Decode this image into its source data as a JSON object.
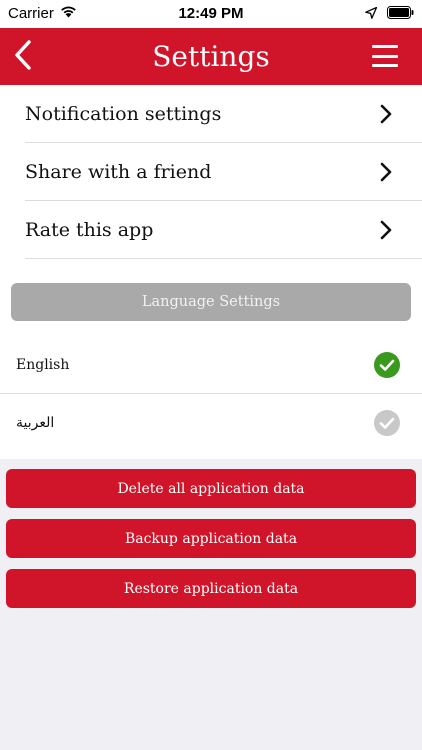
{
  "status_bar": {
    "carrier": "Carrier",
    "time": "12:49 PM"
  },
  "navbar": {
    "title": "Settings",
    "back_icon": "chevron-left-icon",
    "menu_icon": "hamburger-menu-icon",
    "bg_color": "#d0142a"
  },
  "settings": {
    "items": [
      {
        "label": "Notification settings",
        "icon": "chevron-right-icon"
      },
      {
        "label": "Share with a friend",
        "icon": "chevron-right-icon"
      },
      {
        "label": "Rate this app",
        "icon": "chevron-right-icon"
      }
    ]
  },
  "language": {
    "header": "Language Settings",
    "options": [
      {
        "label": "English",
        "selected": true,
        "check_color": "#3a9a1e"
      },
      {
        "label": "العربية",
        "selected": false,
        "check_color": "#c8c8c8"
      }
    ]
  },
  "actions": {
    "delete_label": "Delete all application data",
    "backup_label": "Backup application data",
    "restore_label": "Restore application data"
  }
}
